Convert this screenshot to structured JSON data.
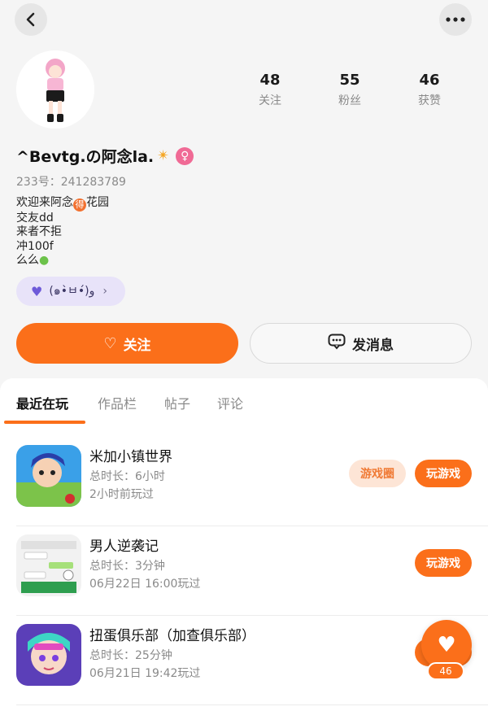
{
  "header": {
    "back_icon": "chevron-left-icon",
    "more_icon": "more-dots-icon"
  },
  "profile": {
    "nickname": "^Bevtg.の阿念la.",
    "uid": "233号：241283789",
    "bio": {
      "line1_a": "欢迎来阿念",
      "line1_badge": "得",
      "line1_b": "花园",
      "line2": "交友dd",
      "line3": "来者不拒",
      "line4": "冲100f",
      "line5": "么么"
    },
    "club": {
      "label": "(๑•̀ㅂ•́)و"
    }
  },
  "stats": [
    {
      "value": "48",
      "label": "关注"
    },
    {
      "value": "55",
      "label": "粉丝"
    },
    {
      "value": "46",
      "label": "获赞"
    }
  ],
  "actions": {
    "follow_label": "关注",
    "message_label": "发消息"
  },
  "tabs": [
    {
      "label": "最近在玩"
    },
    {
      "label": "作品栏"
    },
    {
      "label": "帖子"
    },
    {
      "label": "评论"
    }
  ],
  "games": [
    {
      "title": "米加小镇世界",
      "duration": "总时长：6小时",
      "last_played": "2小时前玩过",
      "circle_label": "游戏圈",
      "play_label": "玩游戏"
    },
    {
      "title": "男人逆袭记",
      "duration": "总时长：3分钟",
      "last_played": "06月22日 16:00玩过",
      "play_label": "玩游戏"
    },
    {
      "title": "扭蛋俱乐部（加查俱乐部）",
      "duration": "总时长：25分钟",
      "last_played": "06月21日 19:42玩过"
    }
  ],
  "fab": {
    "count": "46"
  },
  "colors": {
    "accent": "#fb6f1a",
    "chip_bg": "#e8e3f9",
    "gender": "#f06a95"
  }
}
